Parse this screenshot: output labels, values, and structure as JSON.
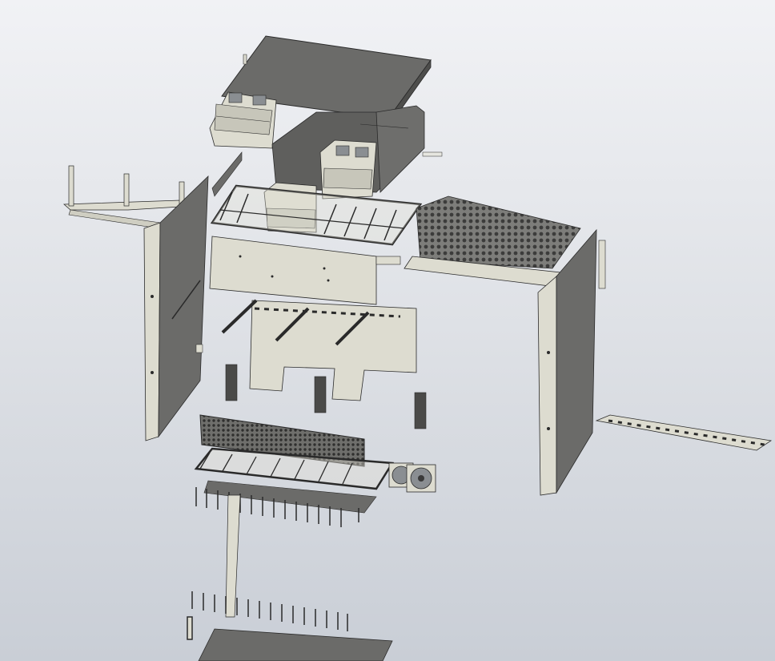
{
  "viewport": {
    "background_top": "#f1f2f5",
    "background_bottom": "#c9ced6"
  },
  "colors": {
    "sheet_metal_dark": "#6b6b69",
    "sheet_metal_beige": "#dddcd0",
    "outline": "#2a2a2a",
    "fan": "#8a8e92"
  },
  "parts": [
    "top-cover",
    "upper-fan-bracket",
    "middle-fan-bracket",
    "rear-fan-tray",
    "left-mounting-bracket",
    "left-side-panel",
    "card-cage-frame",
    "mesh-top-panel",
    "front-mid-panel",
    "backplane-board",
    "card-guides",
    "right-side-panel",
    "right-connector-strip",
    "front-mesh-panel",
    "lower-card-cage",
    "cooling-fans",
    "front-connectors-row",
    "lower-connectors-row",
    "base-plate"
  ]
}
